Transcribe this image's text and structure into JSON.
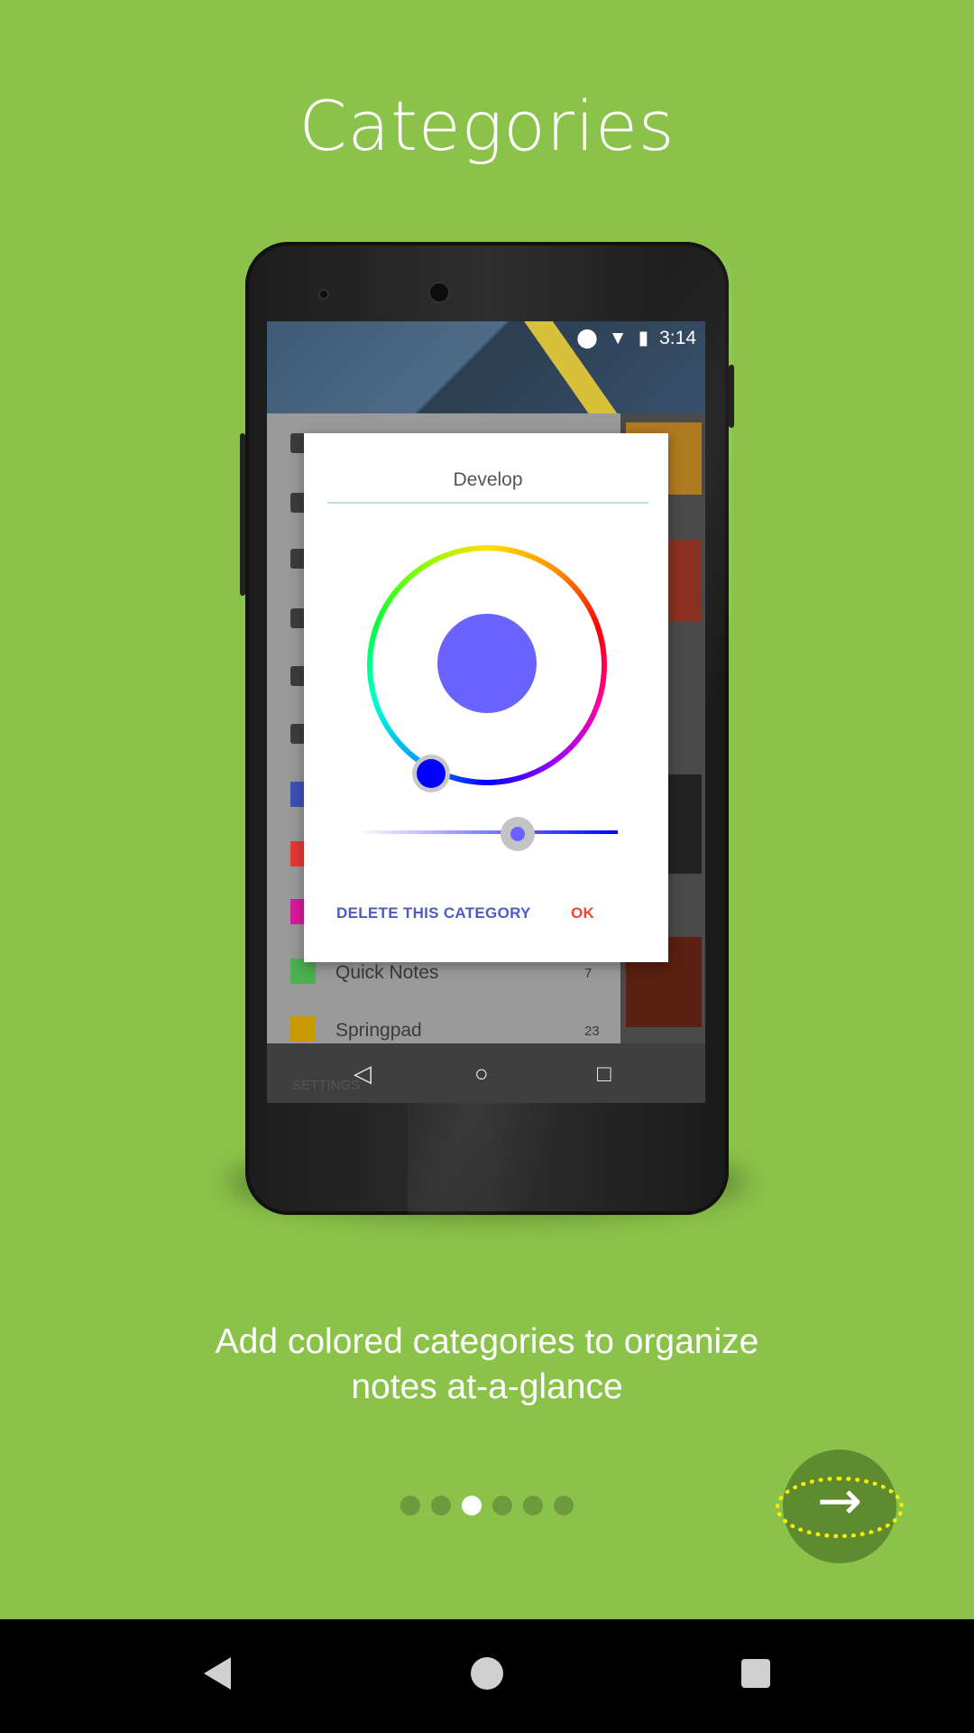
{
  "page": {
    "title": "Categories",
    "description_line1": "Add colored categories to organize",
    "description_line2": "notes at-a-glance"
  },
  "phone_screen": {
    "status_time": "3:14",
    "dialog": {
      "title": "Develop",
      "delete_label": "DELETE THIS CATEGORY",
      "ok_label": "OK",
      "selected_color": "#6b63ff"
    },
    "categories": [
      {
        "name": "Quick Notes",
        "count": "7",
        "color": "#4caf50"
      },
      {
        "name": "Springpad",
        "count": "23",
        "color": "#c99a00"
      }
    ],
    "settings_label": "SETTINGS",
    "nav_back": "◁",
    "nav_home": "○",
    "nav_recent": "□"
  },
  "pager": {
    "count": 6,
    "active_index": 2
  },
  "next_button": {
    "icon": "arrow-right-icon",
    "glyph": "→"
  },
  "colors": {
    "background": "#8bc34a",
    "next_button": "#5e8a30",
    "ok": "#f44336",
    "delete": "#4e5bc4"
  }
}
